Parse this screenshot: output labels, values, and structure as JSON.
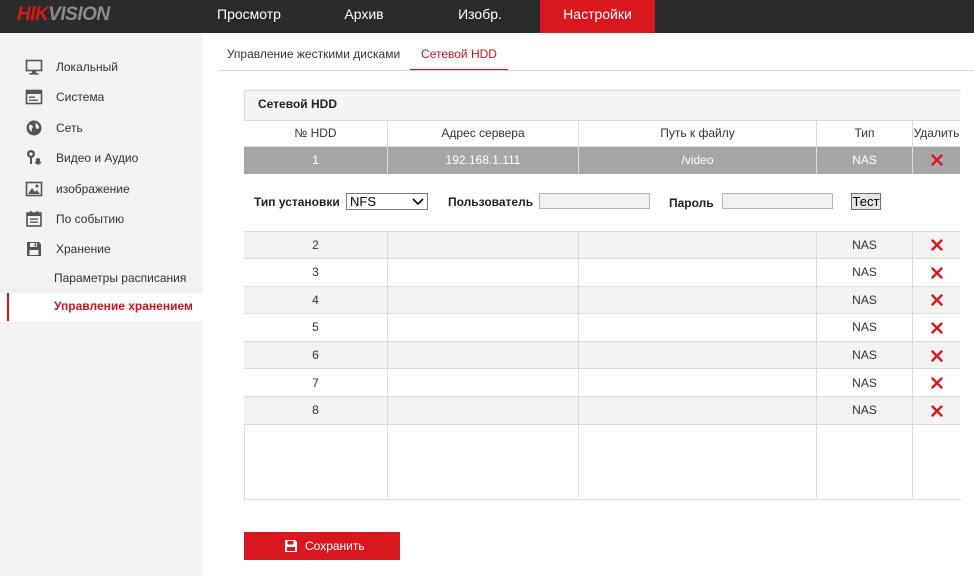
{
  "header": {
    "logo_main": "HIK",
    "logo_rest": "VISION",
    "nav": [
      "Просмотр",
      "Архив",
      "Изобр.",
      "Настройки"
    ],
    "active_nav": 3
  },
  "sidebar": {
    "items": [
      {
        "label": "Локальный",
        "icon": "monitor-icon"
      },
      {
        "label": "Система",
        "icon": "system-icon"
      },
      {
        "label": "Сеть",
        "icon": "globe-icon"
      },
      {
        "label": "Видео и Аудио",
        "icon": "camera-mic-icon"
      },
      {
        "label": "изображение",
        "icon": "image-icon"
      },
      {
        "label": "По событию",
        "icon": "calendar-icon"
      },
      {
        "label": "Хранение",
        "icon": "floppy-icon"
      }
    ],
    "subitems": [
      {
        "label": "Параметры расписания"
      },
      {
        "label": "Управление хранением",
        "active": true
      }
    ]
  },
  "tabs": [
    "Управление жесткими дисками",
    "Сетевой HDD"
  ],
  "active_tab": 1,
  "panel": {
    "title": "Сетевой HDD",
    "columns": [
      "№ HDD",
      "Адрес сервера",
      "Путь к файлу",
      "Тип",
      "Удалить"
    ],
    "rows": [
      {
        "no": "1",
        "address": "192.168.1.111",
        "path": "/video",
        "type": "NAS",
        "selected": true
      },
      {
        "no": "2",
        "address": "",
        "path": "",
        "type": "NAS"
      },
      {
        "no": "3",
        "address": "",
        "path": "",
        "type": "NAS"
      },
      {
        "no": "4",
        "address": "",
        "path": "",
        "type": "NAS"
      },
      {
        "no": "5",
        "address": "",
        "path": "",
        "type": "NAS"
      },
      {
        "no": "6",
        "address": "",
        "path": "",
        "type": "NAS"
      },
      {
        "no": "7",
        "address": "",
        "path": "",
        "type": "NAS"
      },
      {
        "no": "8",
        "address": "",
        "path": "",
        "type": "NAS"
      }
    ],
    "settings": {
      "mount_type_label": "Тип установки",
      "mount_type_value": "NFS",
      "user_label": "Пользователь",
      "user_value": "",
      "password_label": "Пароль",
      "password_value": "",
      "test_label": "Тест"
    }
  },
  "save_label": "Сохранить",
  "colors": {
    "accent": "#d8181e",
    "topbar": "#2b2b2b",
    "sidebar": "#f2f2f2",
    "selected_row": "#a6a6a6"
  }
}
